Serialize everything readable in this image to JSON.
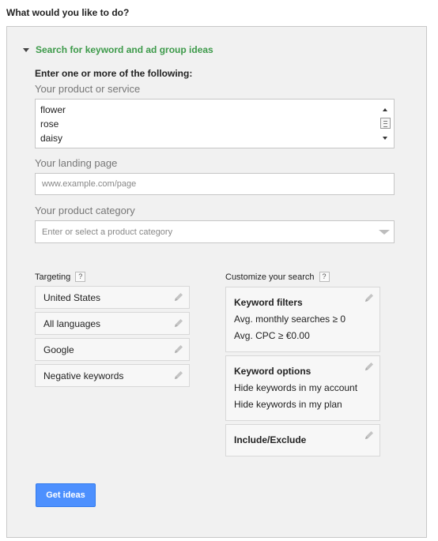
{
  "page_question": "What would you like to do?",
  "section": {
    "title": "Search for keyword and ad group ideas",
    "instruction": "Enter one or more of the following:"
  },
  "product_service": {
    "label": "Your product or service",
    "lines": [
      "flower",
      "rose",
      "daisy"
    ]
  },
  "landing_page": {
    "label": "Your landing page",
    "placeholder": "www.example.com/page",
    "value": ""
  },
  "product_category": {
    "label": "Your product category",
    "placeholder": "Enter or select a product category"
  },
  "targeting": {
    "title": "Targeting",
    "help": "?",
    "items": [
      {
        "label": "United States"
      },
      {
        "label": "All languages"
      },
      {
        "label": "Google"
      },
      {
        "label": "Negative keywords"
      }
    ]
  },
  "customize": {
    "title": "Customize your search",
    "help": "?",
    "keyword_filters": {
      "title": "Keyword filters",
      "lines": [
        "Avg. monthly searches ≥ 0",
        "Avg. CPC ≥ €0.00"
      ]
    },
    "keyword_options": {
      "title": "Keyword options",
      "lines": [
        "Hide keywords in my account",
        "Hide keywords in my plan"
      ]
    },
    "include_exclude": {
      "title": "Include/Exclude"
    }
  },
  "get_ideas_button": "Get ideas",
  "icons": {
    "toggle": "triangle-down-icon",
    "edit": "pencil-icon",
    "help": "help-icon",
    "dropdown": "chevron-down-icon"
  },
  "colors": {
    "accent_green": "#3d9a4a",
    "button_blue": "#4d90fe",
    "panel_bg": "#f1f1f1"
  }
}
